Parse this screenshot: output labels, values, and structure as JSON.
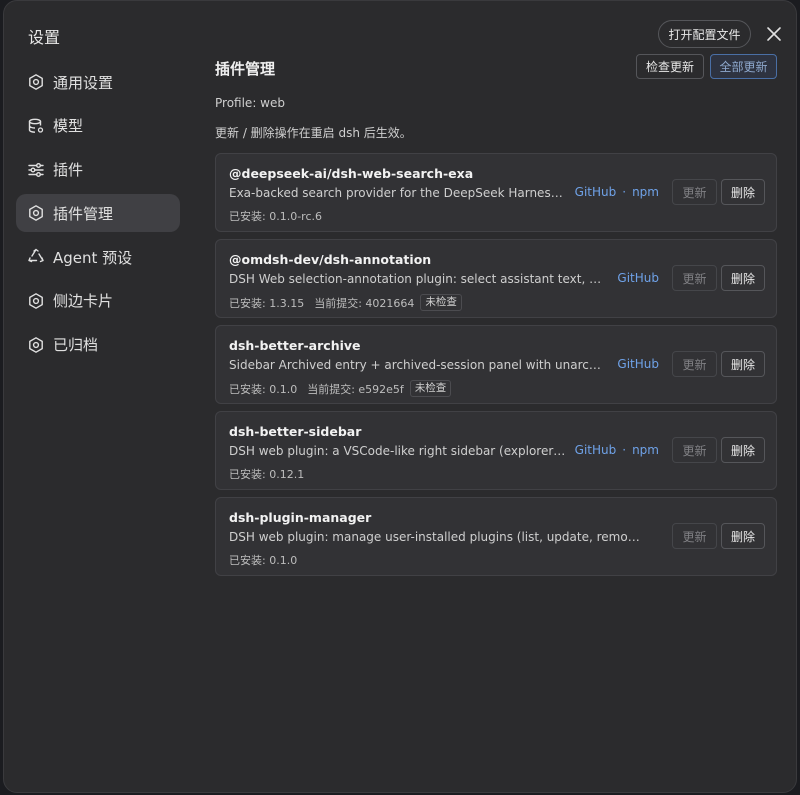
{
  "window": {
    "title": "设置",
    "open_config_label": "打开配置文件"
  },
  "sidebar": {
    "items": [
      {
        "label": "通用设置",
        "icon": "gear-icon"
      },
      {
        "label": "模型",
        "icon": "database-icon"
      },
      {
        "label": "插件",
        "icon": "sliders-icon"
      },
      {
        "label": "插件管理",
        "icon": "gear-icon",
        "active": true
      },
      {
        "label": "Agent 预设",
        "icon": "recycle-icon"
      },
      {
        "label": "侧边卡片",
        "icon": "gear-icon"
      },
      {
        "label": "已归档",
        "icon": "gear-icon"
      }
    ]
  },
  "main": {
    "title": "插件管理",
    "check_update_label": "检查更新",
    "update_all_label": "全部更新",
    "profile": "Profile: web",
    "notice": "更新 / 删除操作在重启 dsh 后生效。",
    "update_label": "更新",
    "delete_label": "删除",
    "plugins": [
      {
        "name": "@deepseek-ai/dsh-web-search-exa",
        "description": "Exa-backed search provider for the DeepSeek Harness web ca...",
        "installed": "已安装: 0.1.0-rc.6",
        "commit": "",
        "badge": "",
        "links": [
          "GitHub",
          "npm"
        ]
      },
      {
        "name": "@omdsh-dev/dsh-annotation",
        "description": "DSH Web selection-annotation plugin: select assistant text, annotate (...",
        "installed": "已安装: 1.3.15",
        "commit": "当前提交: 4021664",
        "badge": "未检查",
        "links": [
          "GitHub"
        ]
      },
      {
        "name": "dsh-better-archive",
        "description": "Sidebar Archived entry + archived-session panel with unarchive and d...",
        "installed": "已安装: 0.1.0",
        "commit": "当前提交: e592e5f",
        "badge": "未检查",
        "links": [
          "GitHub"
        ]
      },
      {
        "name": "dsh-better-sidebar",
        "description": "DSH web plugin: a VSCode-like right sidebar (explorer / editor ...",
        "installed": "已安装: 0.12.1",
        "commit": "",
        "badge": "",
        "links": [
          "GitHub",
          "npm"
        ]
      },
      {
        "name": "dsh-plugin-manager",
        "description": "DSH web plugin: manage user-installed plugins (list, update, remove) from a ...",
        "installed": "已安装: 0.1.0",
        "commit": "",
        "badge": "",
        "links": []
      }
    ]
  }
}
